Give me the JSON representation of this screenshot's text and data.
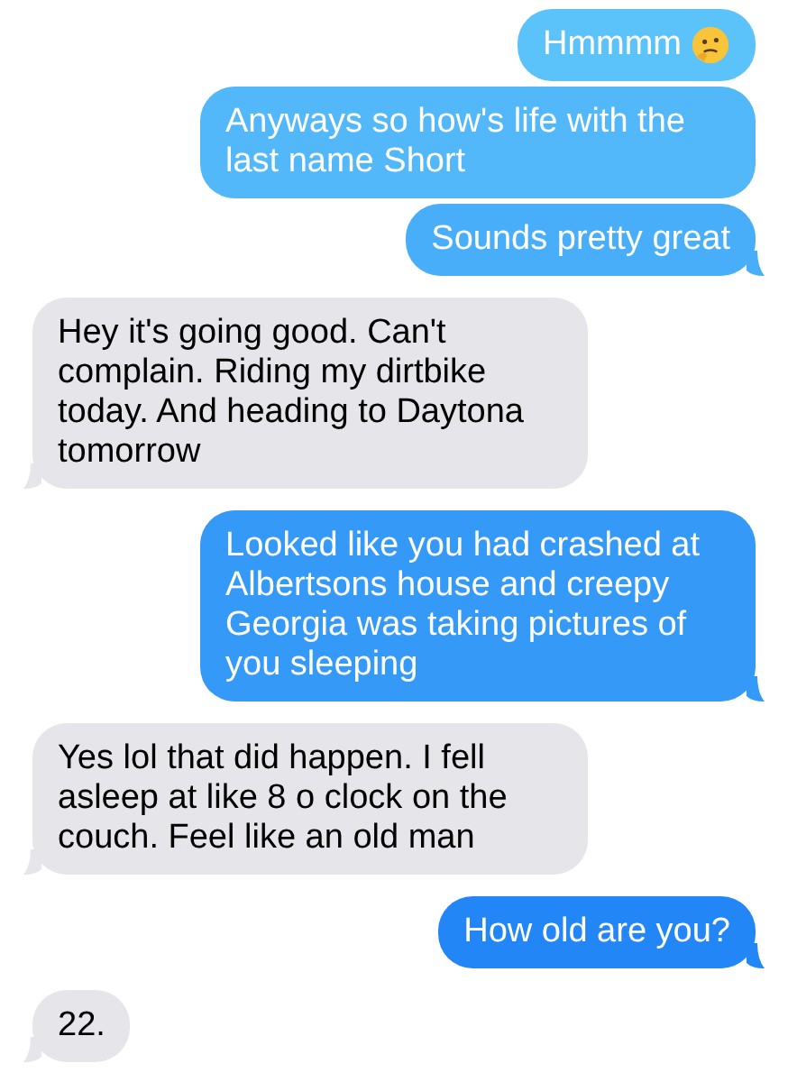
{
  "messages": [
    {
      "kind": "sent",
      "text": "Hmmmm",
      "emoji": true,
      "tail": false
    },
    {
      "kind": "sent",
      "text": "Anyways so how's life with the last name Short",
      "emoji": false,
      "tail": false
    },
    {
      "kind": "sent",
      "text": "Sounds pretty great",
      "emoji": false,
      "tail": true
    },
    {
      "kind": "received",
      "text": "Hey it's going good. Can't complain. Riding my dirtbike today. And heading to Daytona tomorrow",
      "emoji": false,
      "tail": true
    },
    {
      "kind": "sent",
      "text": "Looked like you had crashed at Albertsons house and creepy Georgia was taking pictures of you sleeping",
      "emoji": false,
      "tail": true
    },
    {
      "kind": "received",
      "text": "Yes lol that did happen. I fell asleep at like 8 o clock on the couch. Feel like an old man",
      "emoji": false,
      "tail": true
    },
    {
      "kind": "sent",
      "text": "How old are you?",
      "emoji": false,
      "tail": true
    },
    {
      "kind": "received",
      "text": "22.",
      "emoji": false,
      "tail": true
    }
  ]
}
